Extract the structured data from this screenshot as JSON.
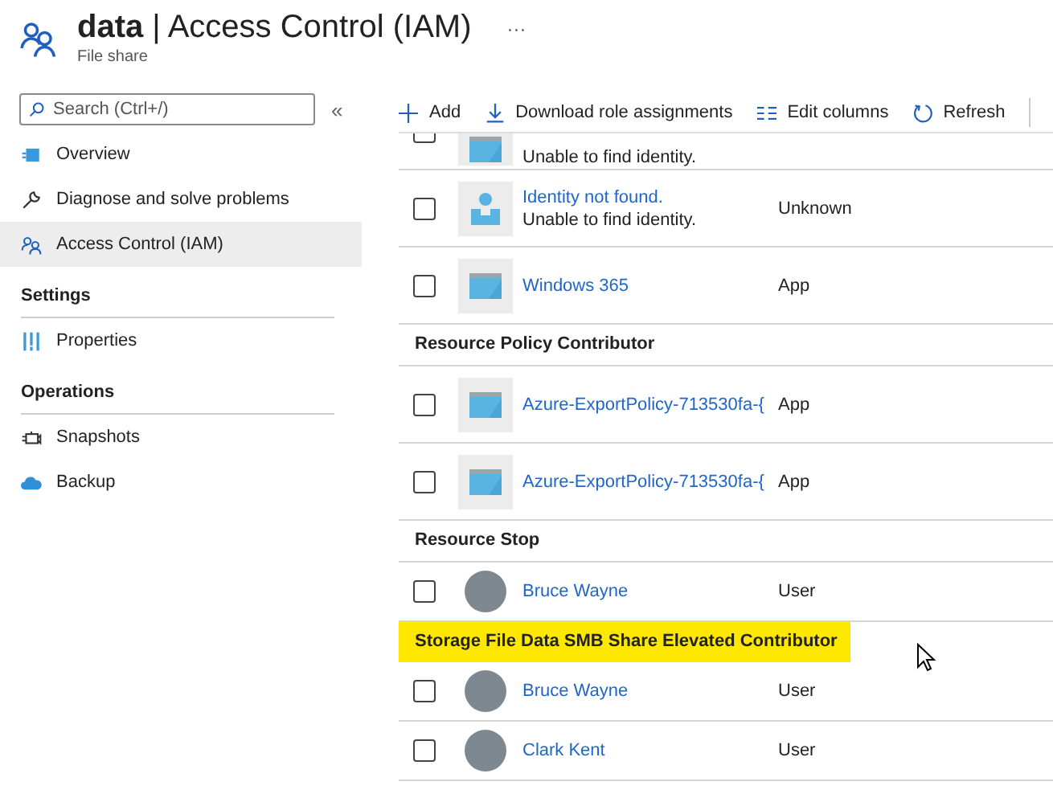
{
  "header": {
    "title": "**data** | Access Control (IAM)",
    "more": "···",
    "subtitle": "File share"
  },
  "sidebar": {
    "search": {
      "placeholder": "Search (Ctrl+/)"
    },
    "collapse": "«",
    "sections": [
      {
        "items": [
          {
            "label": "Overview",
            "selected": false
          },
          {
            "label": "Diagnose and solve problems",
            "selected": false
          },
          {
            "label": "Access Control (IAM)",
            "selected": true
          }
        ]
      },
      {
        "title": "Settings",
        "items": [
          {
            "label": "Properties",
            "selected": false
          }
        ]
      },
      {
        "title": "Operations",
        "items": [
          {
            "label": "Snapshots",
            "selected": false
          },
          {
            "label": "Backup",
            "selected": false
          }
        ]
      }
    ]
  },
  "toolbar": [
    {
      "label": "Add"
    },
    {
      "label": "Download role assignments"
    },
    {
      "label": "Edit columns"
    },
    {
      "label": "Refresh"
    }
  ],
  "list": [
    {
      "kind": "partial",
      "detail": "Unable to find identity.",
      "checked": false
    },
    {
      "kind": "unknown",
      "name": "Identity not found.",
      "detail": "Unable to find identity.",
      "type": "Unknown",
      "checked": false
    },
    {
      "kind": "app",
      "name": "Windows 365",
      "type": "App",
      "checked": false
    },
    {
      "kind": "group",
      "title": "Resource Policy Contributor",
      "highlighted": false
    },
    {
      "kind": "app",
      "name": "Azure-ExportPolicy-713530fa-{",
      "type": "App",
      "checked": false
    },
    {
      "kind": "app",
      "name": "Azure-ExportPolicy-713530fa-{",
      "type": "App",
      "checked": false
    },
    {
      "kind": "group",
      "title": "Resource Stop",
      "highlighted": false
    },
    {
      "kind": "user",
      "name": "Bruce Wayne",
      "type": "User",
      "checked": false
    },
    {
      "kind": "group",
      "title": "Storage File Data SMB Share Elevated Contributor",
      "highlighted": true
    },
    {
      "kind": "user",
      "name": "Bruce Wayne",
      "type": "User",
      "checked": false
    },
    {
      "kind": "user",
      "name": "Clark Kent",
      "type": "User",
      "checked": false
    }
  ]
}
